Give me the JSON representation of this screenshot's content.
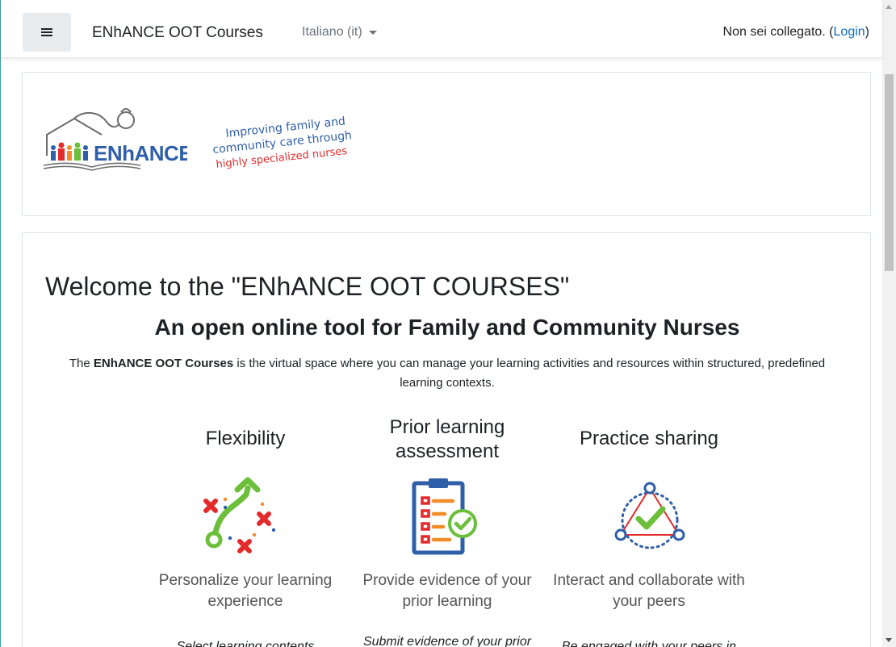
{
  "navbar": {
    "site_name": "ENhANCE OOT Courses",
    "language": "Italiano (it)",
    "login_prefix": "Non sei collegato. (",
    "login_link": "Login",
    "login_suffix": ")"
  },
  "header": {
    "logo_text": "ENhANCE",
    "tagline_line1": "Improving family and",
    "tagline_line2": "community care through",
    "tagline_line3": "highly specialized nurses"
  },
  "main": {
    "welcome": "Welcome to the \"ENhANCE OOT COURSES\"",
    "subtitle": "An open online tool for Family and Community Nurses",
    "intro_prefix": "The ",
    "intro_bold": "ENhANCE OOT Courses",
    "intro_rest": " is the virtual space where you can manage your learning activities and resources within structured, predefined learning contexts.",
    "features": [
      {
        "title": "Flexibility",
        "description": "Personalize your learning experience",
        "detail": "Select learning contents"
      },
      {
        "title": "Prior learning assessment",
        "description": "Provide evidence of your prior learning",
        "detail": "Submit evidence of your prior"
      },
      {
        "title": "Practice sharing",
        "description": "Interact and collaborate with your peers",
        "detail": "Be engaged with your peers in"
      }
    ]
  },
  "colors": {
    "link": "#0f6cbf",
    "red": "#e32b2b",
    "green": "#6bbf3a",
    "blue": "#2f5fa8",
    "orange": "#f28c28"
  }
}
